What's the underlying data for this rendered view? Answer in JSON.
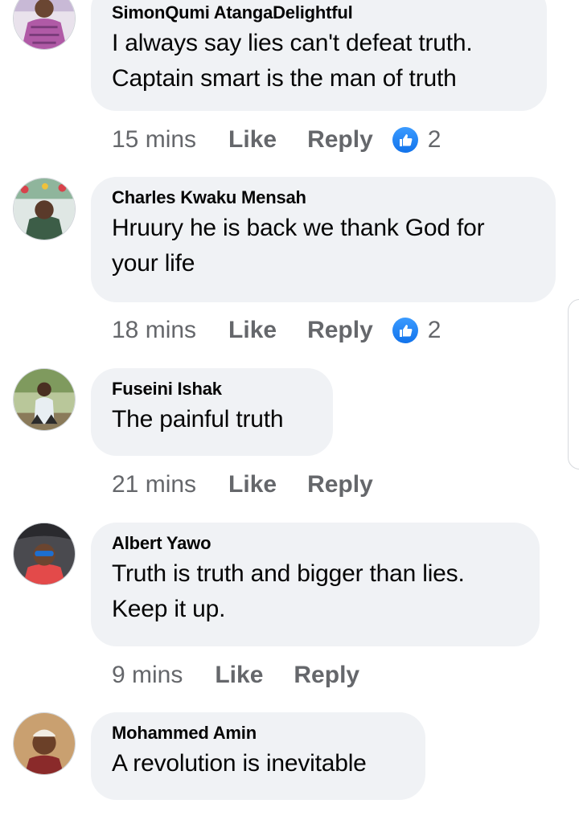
{
  "comments": [
    {
      "author": "SimonQumi AtangaDelightful",
      "text": "I always say lies can't defeat truth. Captain smart is the man of truth",
      "time": "15 mins",
      "like_label": "Like",
      "reply_label": "Reply",
      "reaction_icon": "like-icon",
      "reaction_count": "2"
    },
    {
      "author": "Charles Kwaku Mensah",
      "text": "Hruury he is back we thank God for your life",
      "time": "18 mins",
      "like_label": "Like",
      "reply_label": "Reply",
      "reaction_icon": "like-icon",
      "reaction_count": "2"
    },
    {
      "author": "Fuseini Ishak",
      "text": "The painful truth",
      "time": "21 mins",
      "like_label": "Like",
      "reply_label": "Reply"
    },
    {
      "author": "Albert Yawo",
      "text": "Truth is truth and bigger than lies. Keep it up.",
      "time": "9 mins",
      "like_label": "Like",
      "reply_label": "Reply"
    },
    {
      "author": "Mohammed Amin",
      "text": "A revolution is inevitable"
    }
  ],
  "colors": {
    "bubble_bg": "#f0f2f5",
    "meta_text": "#65676b",
    "name_text": "#050505",
    "like_blue": "#1877f2"
  }
}
